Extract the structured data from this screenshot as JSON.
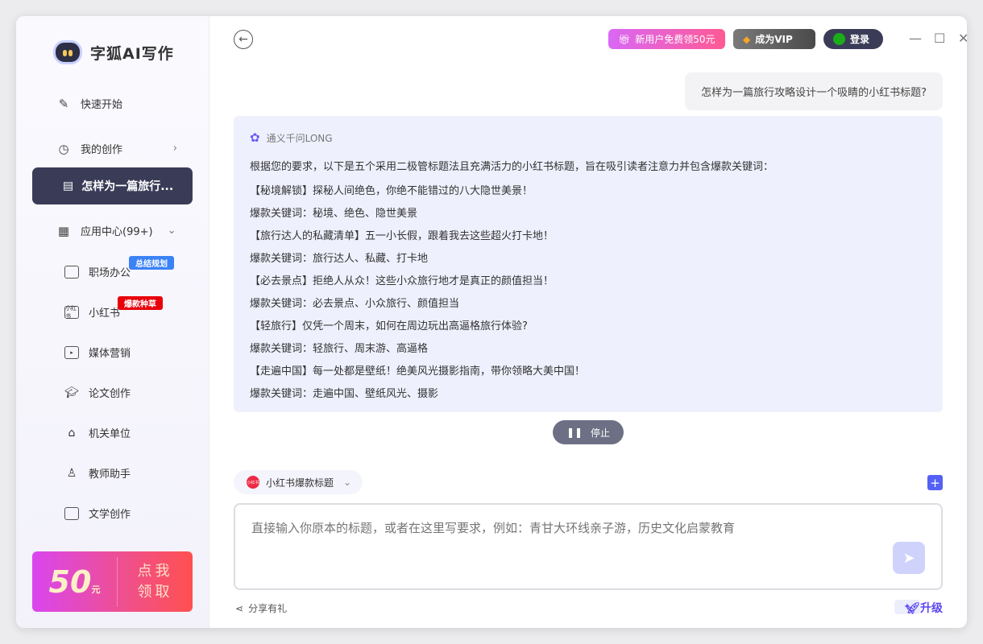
{
  "app": {
    "name": "字狐AI写作"
  },
  "sidebar": {
    "quick_start": "快速开始",
    "my_creations": "我的创作",
    "active_chat": "怎样为一篇旅行...",
    "app_center": "应用中心(99+)",
    "items": [
      {
        "label": "职场办公",
        "tag": "总结规划",
        "tag_color": "#3b82f6"
      },
      {
        "label": "小红书",
        "tag": "爆款种草",
        "tag_color": "#e8000b",
        "icon_text": "小红书"
      },
      {
        "label": "媒体营销"
      },
      {
        "label": "论文创作"
      },
      {
        "label": "机关单位"
      },
      {
        "label": "教师助手"
      },
      {
        "label": "文学创作"
      }
    ],
    "coupon": {
      "amount": "50",
      "unit": "元",
      "cta": "点我领取"
    }
  },
  "header": {
    "promo": "新用户免费领50元",
    "vip": "成为VIP",
    "login": "登录"
  },
  "chat": {
    "question": "怎样为一篇旅行攻略设计一个吸睛的小红书标题?",
    "model": "通义千问LONG",
    "lines": [
      "根据您的要求，以下是五个采用二极管标题法且充满活力的小红书标题，旨在吸引读者注意力并包含爆款关键词：",
      "【秘境解锁】探秘人间绝色，你绝不能错过的八大隐世美景！",
      "爆款关键词：秘境、绝色、隐世美景",
      "【旅行达人的私藏清单】五一小长假，跟着我去这些超火打卡地！",
      "爆款关键词：旅行达人、私藏、打卡地",
      "【必去景点】拒绝人从众！这些小众旅行地才是真正的颜值担当！",
      "爆款关键词：必去景点、小众旅行、颜值担当",
      "【轻旅行】仅凭一个周末，如何在周边玩出高逼格旅行体验?",
      "爆款关键词：轻旅行、周末游、高逼格",
      "【走遍中国】每一处都是壁纸！绝美风光摄影指南，带你领略大美中国！",
      "爆款关键词：走遍中国、壁纸风光、摄影"
    ],
    "stop": "停止"
  },
  "composer": {
    "template": "小红书爆款标题",
    "template_icon_text": "小红书",
    "placeholder": "直接输入你原本的标题，或者在这里写要求，例如：青甘大环线亲子游，历史文化启蒙教育",
    "share": "分享有礼",
    "upgrade": "升级"
  }
}
